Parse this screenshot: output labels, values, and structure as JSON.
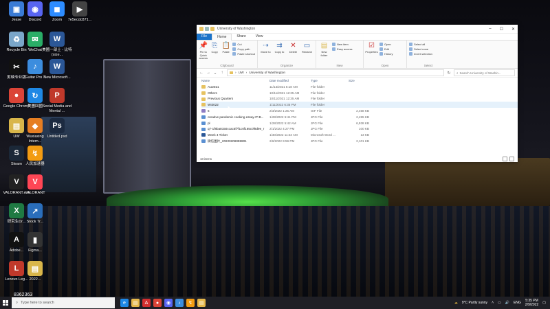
{
  "desktop_icons": [
    {
      "label": "Jesse",
      "color": "#3a7bd5",
      "glyph": "▣"
    },
    {
      "label": "Discord",
      "color": "#5865f2",
      "glyph": "◉"
    },
    {
      "label": "Zoom",
      "color": "#2d8cff",
      "glyph": "◼"
    },
    {
      "label": "7e5ecdc871...",
      "color": "#444",
      "glyph": "▶"
    },
    {
      "label": "Recycle Bin",
      "color": "#7aa6c9",
      "glyph": "♻"
    },
    {
      "label": "WeChat",
      "color": "#2aae67",
      "glyph": "✉"
    },
    {
      "label": "美國一部土 - 比特 (size...",
      "color": "#2b5797",
      "glyph": "W"
    },
    {
      "label": "剪映专业版",
      "color": "#111",
      "glyph": "✂"
    },
    {
      "label": "Guitar Pro 7",
      "color": "#3c8dde",
      "glyph": "♪"
    },
    {
      "label": "New Microsoft...",
      "color": "#2b5797",
      "glyph": "W"
    },
    {
      "label": "Google Chrome",
      "color": "#db4437",
      "glyph": "●"
    },
    {
      "label": "美團回國",
      "color": "#1e88e5",
      "glyph": "↻"
    },
    {
      "label": "Social Media and Mental ...",
      "color": "#c0392b",
      "glyph": "P"
    },
    {
      "label": "UW",
      "color": "#d9b64a",
      "glyph": "▤"
    },
    {
      "label": "Wuxiaxing Intern...",
      "color": "#e67e22",
      "glyph": "◆"
    },
    {
      "label": "Untitled.psd",
      "color": "#1c2a40",
      "glyph": "Ps"
    },
    {
      "label": "Steam",
      "color": "#1b2838",
      "glyph": "S"
    },
    {
      "label": "人民加速器",
      "color": "#f39c12",
      "glyph": "↯"
    },
    {
      "label": "VALORANT",
      "color": "#ff4655",
      "glyph": "V"
    },
    {
      "label": "VALORANT.exe",
      "color": "#222",
      "glyph": "V"
    },
    {
      "label": "研究生Dr...",
      "color": "#1f7a43",
      "glyph": "X"
    },
    {
      "label": "Stock Tr...",
      "color": "#2a6ebb",
      "glyph": "↗"
    },
    {
      "label": "Adobe...",
      "color": "#111",
      "glyph": "A"
    },
    {
      "label": "Figma...",
      "color": "#333",
      "glyph": "▮"
    },
    {
      "label": "Lenovo Leg...",
      "color": "#c0392b",
      "glyph": "L"
    },
    {
      "label": "2022...",
      "color": "#d9b64a",
      "glyph": "▤"
    }
  ],
  "watermark": "8362363",
  "explorer": {
    "title": "University of Washington",
    "menu_tabs": [
      "File",
      "Home",
      "Share",
      "View"
    ],
    "ribbon": {
      "clipboard": {
        "name": "Clipboard",
        "pin": "Pin to Quick access",
        "copy": "Copy",
        "paste": "Paste",
        "cut": "Cut",
        "copy_path": "Copy path",
        "paste_shortcut": "Paste shortcut"
      },
      "organize": {
        "name": "Organize",
        "move_to": "Move to",
        "copy_to": "Copy to",
        "delete": "Delete",
        "rename": "Rename"
      },
      "new": {
        "name": "New",
        "new_folder": "New folder",
        "new_item": "New item",
        "easy_access": "Easy access"
      },
      "open": {
        "name": "Open",
        "properties": "Properties",
        "open": "Open",
        "edit": "Edit",
        "history": "History"
      },
      "select": {
        "name": "Select",
        "select_all": "Select all",
        "select_none": "Select none",
        "invert": "Invert selection"
      }
    },
    "address": {
      "path": [
        "UW",
        "University of Washington"
      ],
      "search_placeholder": "Search University of Washin..."
    },
    "columns": {
      "name": "Name",
      "date": "Date modified",
      "type": "Type",
      "size": "Size"
    },
    "files": [
      {
        "name": "AU2021",
        "date": "11/13/2021 5:18 AM",
        "type": "File folder",
        "size": "",
        "kind": "folder"
      },
      {
        "name": "Others",
        "date": "10/11/2021 12:35 AM",
        "type": "File folder",
        "size": "",
        "kind": "folder"
      },
      {
        "name": "Previous Quarters",
        "date": "10/11/2021 12:35 AM",
        "type": "File folder",
        "size": "",
        "kind": "folder"
      },
      {
        "name": "WI2022",
        "date": "1/11/2022 6:35 PM",
        "type": "File folder",
        "size": "",
        "kind": "folder"
      },
      {
        "name": "6",
        "date": "2/3/2022 1:25 AM",
        "type": "GIF File",
        "size": "2,458 KB",
        "kind": "gif"
      },
      {
        "name": "creative pandemic cooking essay-IT-B...",
        "date": "1/28/2022 5:41 PM",
        "type": "JPG File",
        "size": "2,455 KB",
        "kind": "jpg"
      },
      {
        "name": "pl",
        "date": "1/28/2022 5:42 AM",
        "type": "JPG File",
        "size": "6,938 KB",
        "kind": "jpg"
      },
      {
        "name": "q7-1f8ba8150ccac5f7f1c0f165c0f9d9e_r",
        "date": "2/1/2022 4:27 PM",
        "type": "JPG File",
        "size": "100 KB",
        "kind": "jpg"
      },
      {
        "name": "Week 4 Ticket",
        "date": "1/30/2022 11:23 AM",
        "type": "Microsoft Word ...",
        "size": "13 KB",
        "kind": "doc"
      },
      {
        "name": "微信图片_20220206095901",
        "date": "2/6/2022 9:59 PM",
        "type": "JPG File",
        "size": "2,101 KB",
        "kind": "jpg"
      }
    ],
    "hover_index": 3,
    "status": "10 items"
  },
  "taskbar": {
    "search_placeholder": "Type here to search",
    "apps": [
      {
        "name": "edge",
        "color": "#1e88e5",
        "glyph": "e"
      },
      {
        "name": "explorer",
        "color": "#e6b84a",
        "glyph": "▤"
      },
      {
        "name": "adobe",
        "color": "#d32f2f",
        "glyph": "A"
      },
      {
        "name": "chrome",
        "color": "#db4437",
        "glyph": "●"
      },
      {
        "name": "discord",
        "color": "#5865f2",
        "glyph": "◉"
      },
      {
        "name": "guitarpro",
        "color": "#3c8dde",
        "glyph": "♪"
      },
      {
        "name": "app",
        "color": "#f39c12",
        "glyph": "↯"
      },
      {
        "name": "files",
        "color": "#e6b84a",
        "glyph": "▤"
      }
    ],
    "weather": "9°C Partly sunny",
    "lang": "ENG",
    "time": "5:35 PM",
    "date": "2/9/2022"
  }
}
